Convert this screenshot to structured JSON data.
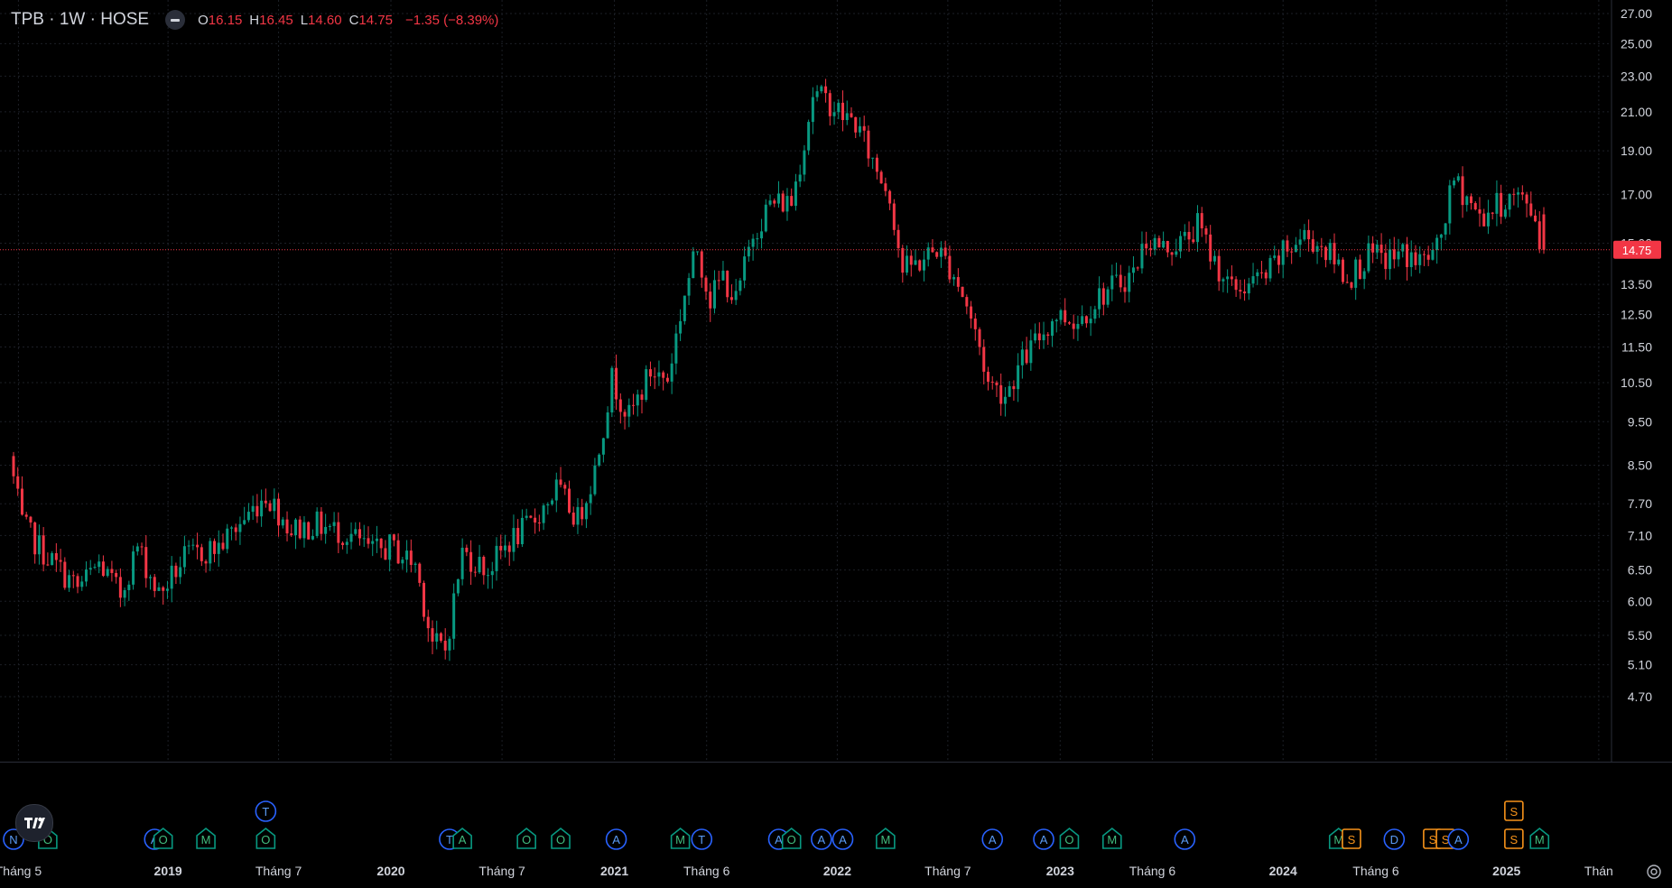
{
  "legend": {
    "symbol": "TPB · 1W · HOSE",
    "o_label": "O",
    "o": "16.15",
    "h_label": "H",
    "h": "16.45",
    "l_label": "L",
    "l": "14.60",
    "c_label": "C",
    "c": "14.75",
    "change": "−1.35 (−8.39%)"
  },
  "last_price_label": "14.75",
  "colors": {
    "up": "#089981",
    "down": "#f23645",
    "background": "#000000",
    "grid": "#1c1f26",
    "text": "#d1d4dc"
  },
  "chart_data": {
    "type": "candlestick",
    "symbol": "TPB",
    "interval": "1W",
    "exchange": "HOSE",
    "y_scale": "log",
    "y_ticks": [
      4.7,
      5.1,
      5.5,
      6.0,
      6.5,
      7.1,
      7.7,
      8.5,
      9.5,
      10.5,
      11.5,
      12.5,
      13.5,
      15.0,
      17.0,
      19.0,
      21.0,
      23.0,
      25.0,
      27.0
    ],
    "x_ticks": [
      {
        "date": "2018-05-01",
        "label": "Tháng 5",
        "bold": false
      },
      {
        "date": "2019-01-01",
        "label": "2019",
        "bold": true
      },
      {
        "date": "2019-07-01",
        "label": "Tháng 7",
        "bold": false
      },
      {
        "date": "2020-01-01",
        "label": "2020",
        "bold": true
      },
      {
        "date": "2020-07-01",
        "label": "Tháng 7",
        "bold": false
      },
      {
        "date": "2021-01-01",
        "label": "2021",
        "bold": true
      },
      {
        "date": "2021-06-01",
        "label": "Tháng 6",
        "bold": false
      },
      {
        "date": "2022-01-01",
        "label": "2022",
        "bold": true
      },
      {
        "date": "2022-07-01",
        "label": "Tháng 7",
        "bold": false
      },
      {
        "date": "2023-01-01",
        "label": "2023",
        "bold": true
      },
      {
        "date": "2023-06-01",
        "label": "Tháng 6",
        "bold": false
      },
      {
        "date": "2024-01-01",
        "label": "2024",
        "bold": true
      },
      {
        "date": "2024-06-01",
        "label": "Tháng 6",
        "bold": false
      },
      {
        "date": "2025-01-01",
        "label": "2025",
        "bold": true
      },
      {
        "date": "2025-06-01",
        "label": "Thán",
        "bold": false
      }
    ],
    "price_path": [
      [
        "2018-04-23",
        8.7
      ],
      [
        "2018-05-14",
        7.3
      ],
      [
        "2018-06-18",
        6.8
      ],
      [
        "2018-08-13",
        6.2
      ],
      [
        "2018-09-17",
        6.6
      ],
      [
        "2018-10-22",
        6.1
      ],
      [
        "2018-11-19",
        6.9
      ],
      [
        "2018-12-24",
        6.1
      ],
      [
        "2019-02-04",
        6.7
      ],
      [
        "2019-04-01",
        6.9
      ],
      [
        "2019-05-20",
        7.5
      ],
      [
        "2019-06-17",
        7.9
      ],
      [
        "2019-07-29",
        7.2
      ],
      [
        "2019-09-09",
        7.3
      ],
      [
        "2019-11-04",
        7.1
      ],
      [
        "2019-12-09",
        6.8
      ],
      [
        "2020-01-06",
        6.9
      ],
      [
        "2020-02-17",
        6.6
      ],
      [
        "2020-03-16",
        5.4
      ],
      [
        "2020-04-06",
        5.3
      ],
      [
        "2020-05-04",
        6.8
      ],
      [
        "2020-06-15",
        6.5
      ],
      [
        "2020-07-20",
        7.0
      ],
      [
        "2020-08-24",
        7.3
      ],
      [
        "2020-10-05",
        8.0
      ],
      [
        "2020-11-09",
        7.4
      ],
      [
        "2020-12-07",
        8.4
      ],
      [
        "2021-01-04",
        10.6
      ],
      [
        "2021-02-01",
        9.6
      ],
      [
        "2021-03-08",
        10.8
      ],
      [
        "2021-04-05",
        10.6
      ],
      [
        "2021-05-03",
        13.2
      ],
      [
        "2021-05-24",
        14.8
      ],
      [
        "2021-06-14",
        13.0
      ],
      [
        "2021-07-05",
        13.8
      ],
      [
        "2021-07-26",
        12.9
      ],
      [
        "2021-08-23",
        15.4
      ],
      [
        "2021-09-20",
        16.6
      ],
      [
        "2021-10-25",
        16.7
      ],
      [
        "2021-11-15",
        19.5
      ],
      [
        "2021-11-29",
        22.0
      ],
      [
        "2021-12-27",
        21.5
      ],
      [
        "2022-01-17",
        20.8
      ],
      [
        "2022-02-07",
        20.4
      ],
      [
        "2022-03-07",
        18.5
      ],
      [
        "2022-04-04",
        17.0
      ],
      [
        "2022-04-25",
        14.0
      ],
      [
        "2022-05-23",
        14.3
      ],
      [
        "2022-06-20",
        14.8
      ],
      [
        "2022-07-18",
        13.9
      ],
      [
        "2022-08-08",
        12.8
      ],
      [
        "2022-08-29",
        11.5
      ],
      [
        "2022-09-12",
        10.5
      ],
      [
        "2022-10-10",
        10.2
      ],
      [
        "2022-11-07",
        11.1
      ],
      [
        "2022-12-05",
        11.8
      ],
      [
        "2023-01-02",
        12.5
      ],
      [
        "2023-02-06",
        12.3
      ],
      [
        "2023-03-13",
        13.1
      ],
      [
        "2023-04-10",
        13.5
      ],
      [
        "2023-05-08",
        13.9
      ],
      [
        "2023-05-29",
        15.2
      ],
      [
        "2023-06-26",
        14.8
      ],
      [
        "2023-07-31",
        15.1
      ],
      [
        "2023-08-21",
        15.7
      ],
      [
        "2023-09-18",
        14.3
      ],
      [
        "2023-10-16",
        13.3
      ],
      [
        "2023-11-13",
        13.5
      ],
      [
        "2023-12-11",
        13.8
      ],
      [
        "2024-01-08",
        14.6
      ],
      [
        "2024-02-12",
        15.3
      ],
      [
        "2024-03-11",
        14.9
      ],
      [
        "2024-04-08",
        14.2
      ],
      [
        "2024-04-22",
        13.7
      ],
      [
        "2024-05-27",
        14.5
      ],
      [
        "2024-06-24",
        14.4
      ],
      [
        "2024-07-22",
        14.6
      ],
      [
        "2024-08-19",
        14.3
      ],
      [
        "2024-09-16",
        14.7
      ],
      [
        "2024-10-14",
        17.6
      ],
      [
        "2024-11-04",
        16.9
      ],
      [
        "2024-11-25",
        16.0
      ],
      [
        "2024-12-23",
        16.5
      ],
      [
        "2025-01-20",
        16.9
      ],
      [
        "2025-02-10",
        16.6
      ],
      [
        "2025-02-24",
        16.15
      ],
      [
        "2025-03-03",
        14.75
      ]
    ],
    "last_candle": {
      "date": "2025-03-03",
      "open": 16.15,
      "high": 16.45,
      "low": 14.6,
      "close": 14.75
    },
    "events": [
      {
        "date": "2018-04-23",
        "label": "N",
        "color": "blue"
      },
      {
        "date": "2018-06-18",
        "label": "O",
        "color": "green"
      },
      {
        "date": "2018-12-10",
        "label": "A",
        "color": "blue"
      },
      {
        "date": "2018-12-24",
        "label": "O",
        "color": "green"
      },
      {
        "date": "2019-03-04",
        "label": "M",
        "color": "green"
      },
      {
        "date": "2019-06-10",
        "label": "O",
        "color": "green"
      },
      {
        "date": "2019-06-10",
        "label": "T",
        "color": "blue",
        "row": 2
      },
      {
        "date": "2020-04-06",
        "label": "T",
        "color": "blue"
      },
      {
        "date": "2020-04-27",
        "label": "A",
        "color": "green"
      },
      {
        "date": "2020-08-10",
        "label": "O",
        "color": "green"
      },
      {
        "date": "2020-10-05",
        "label": "O",
        "color": "green"
      },
      {
        "date": "2021-01-04",
        "label": "A",
        "color": "blue"
      },
      {
        "date": "2021-04-19",
        "label": "M",
        "color": "green"
      },
      {
        "date": "2021-05-24",
        "label": "T",
        "color": "blue"
      },
      {
        "date": "2021-09-27",
        "label": "A",
        "color": "blue"
      },
      {
        "date": "2021-10-18",
        "label": "O",
        "color": "green"
      },
      {
        "date": "2021-12-06",
        "label": "A",
        "color": "blue"
      },
      {
        "date": "2022-01-10",
        "label": "A",
        "color": "blue"
      },
      {
        "date": "2022-03-21",
        "label": "M",
        "color": "green"
      },
      {
        "date": "2022-09-12",
        "label": "A",
        "color": "blue"
      },
      {
        "date": "2022-12-05",
        "label": "A",
        "color": "blue"
      },
      {
        "date": "2023-01-16",
        "label": "O",
        "color": "green"
      },
      {
        "date": "2023-03-27",
        "label": "M",
        "color": "green"
      },
      {
        "date": "2023-07-24",
        "label": "A",
        "color": "blue"
      },
      {
        "date": "2024-04-01",
        "label": "M",
        "color": "green"
      },
      {
        "date": "2024-04-22",
        "label": "S",
        "color": "orange"
      },
      {
        "date": "2024-07-01",
        "label": "D",
        "color": "blue"
      },
      {
        "date": "2024-09-02",
        "label": "S",
        "color": "orange"
      },
      {
        "date": "2024-09-23",
        "label": "S",
        "color": "orange"
      },
      {
        "date": "2024-10-14",
        "label": "A",
        "color": "blue"
      },
      {
        "date": "2025-01-13",
        "label": "S",
        "color": "orange"
      },
      {
        "date": "2025-01-13",
        "label": "S",
        "color": "orange",
        "row": 2
      },
      {
        "date": "2025-02-24",
        "label": "M",
        "color": "green"
      }
    ]
  }
}
